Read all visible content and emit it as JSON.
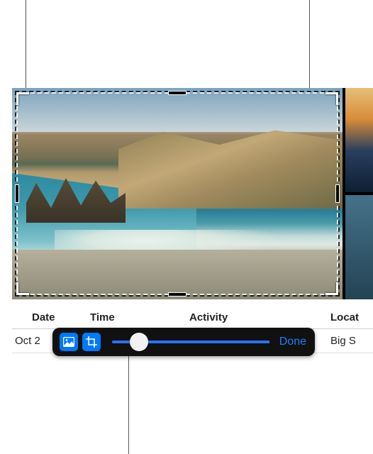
{
  "table": {
    "headers": {
      "date": "Date",
      "time": "Time",
      "activity": "Activity",
      "location": "Locat"
    },
    "row": {
      "date": "Oct 2",
      "location": "Big S"
    }
  },
  "toolbar": {
    "photo_icon": "photo-icon",
    "crop_icon": "crop-icon",
    "done_label": "Done",
    "slider_position_pct": 20
  },
  "callout_lines": true
}
